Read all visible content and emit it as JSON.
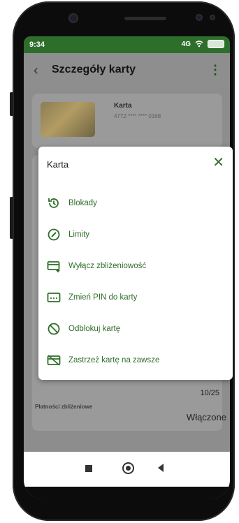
{
  "status_bar": {
    "time": "9:34",
    "signal": "4G"
  },
  "app_bar": {
    "title": "Szczegóły karty"
  },
  "card_info": {
    "label": "Karta",
    "number": "4772 **** **** 0168"
  },
  "behind": {
    "counter": "10/25",
    "contactless_label": "Płatności zbliżeniowe",
    "contactless_value": "Włączone"
  },
  "dialog": {
    "title": "Karta",
    "items": [
      {
        "icon": "lock-history-icon",
        "label": "Blokady"
      },
      {
        "icon": "gauge-icon",
        "label": "Limity"
      },
      {
        "icon": "card-plus-icon",
        "label": "Wyłącz zbliżeniowość"
      },
      {
        "icon": "pin-card-icon",
        "label": "Zmień PIN do karty"
      },
      {
        "icon": "block-icon",
        "label": "Odblokuj kartę"
      },
      {
        "icon": "card-cancel-icon",
        "label": "Zastrzeż kartę na zawsze"
      }
    ]
  },
  "colors": {
    "accent": "#2f6e2a",
    "status_bg": "#2e6e2b",
    "overlay": "#8d8d8d"
  }
}
